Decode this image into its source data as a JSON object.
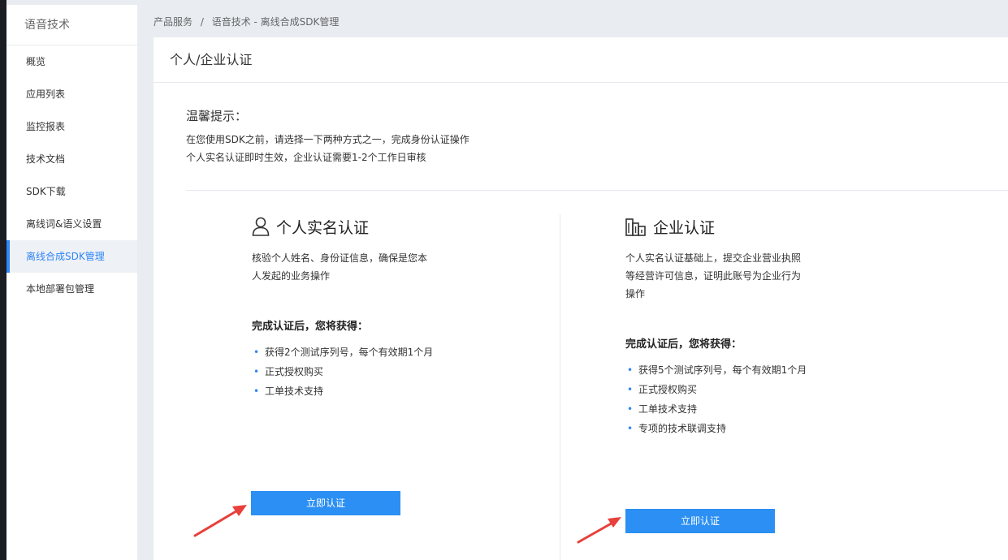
{
  "sidebar": {
    "title": "语音技术",
    "items": [
      {
        "label": "概览"
      },
      {
        "label": "应用列表"
      },
      {
        "label": "监控报表"
      },
      {
        "label": "技术文档"
      },
      {
        "label": "SDK下载"
      },
      {
        "label": "离线词&语义设置"
      },
      {
        "label": "离线合成SDK管理",
        "active": true
      },
      {
        "label": "本地部署包管理"
      }
    ]
  },
  "breadcrumb": {
    "root": "产品服务",
    "separator": "/",
    "current": "语音技术 - 离线合成SDK管理"
  },
  "main": {
    "title": "个人/企业认证",
    "tip": {
      "title": "温馨提示：",
      "line1": "在您使用SDK之前，请选择一下两种方式之一，完成身份认证操作",
      "line2": "个人实名认证即时生效，企业认证需要1-2个工作日审核"
    },
    "personal": {
      "icon": "person-icon",
      "title": "个人实名认证",
      "desc_line1": "核验个人姓名、身份证信息，确保是您本",
      "desc_line2": "人发起的业务操作",
      "gain_title": "完成认证后，您将获得：",
      "benefits": [
        "获得2个测试序列号，每个有效期1个月",
        "正式授权购买",
        "工单技术支持"
      ],
      "button": "立即认证"
    },
    "enterprise": {
      "icon": "building-icon",
      "title": "企业认证",
      "desc_line1": "个人实名认证基础上，提交企业营业执照",
      "desc_line2": "等经营许可信息，证明此账号为企业行为",
      "desc_line3": "操作",
      "gain_title": "完成认证后，您将获得：",
      "benefits": [
        "获得5个测试序列号，每个有效期1个月",
        "正式授权购买",
        "工单技术支持",
        "专项的技术联调支持"
      ],
      "button": "立即认证"
    }
  },
  "colors": {
    "accent": "#2b8ff3",
    "annotation_arrow": "#e8403a"
  }
}
